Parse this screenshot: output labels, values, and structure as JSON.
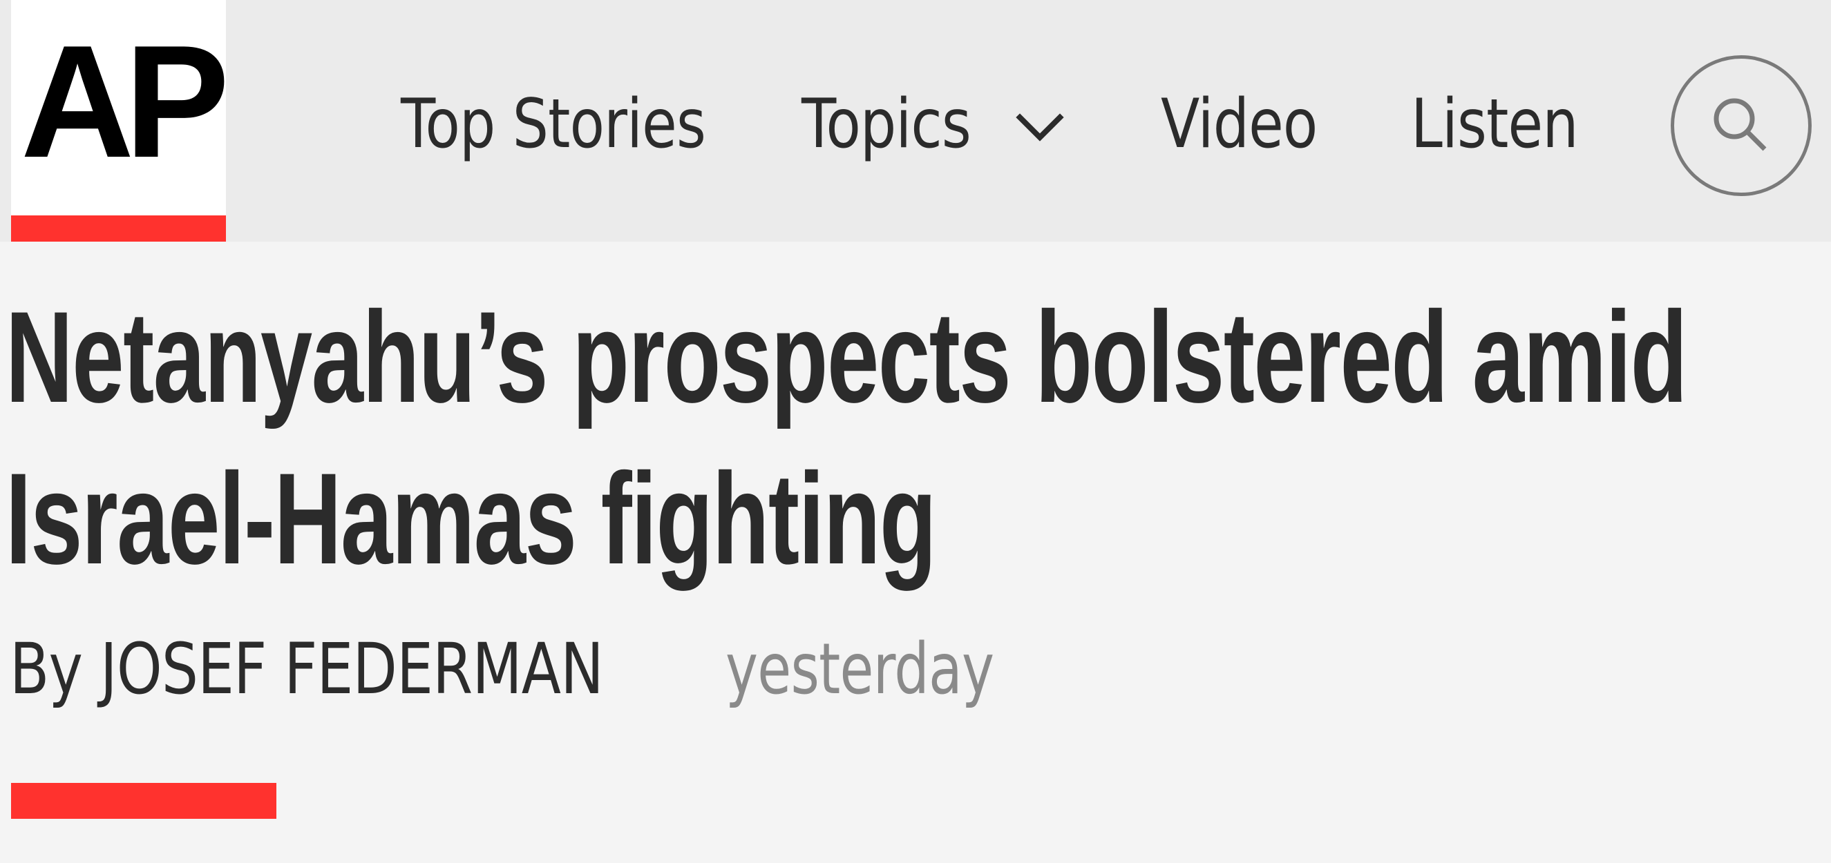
{
  "header": {
    "logo_text": "AP",
    "nav": {
      "top_stories": "Top Stories",
      "topics": "Topics",
      "video": "Video",
      "listen": "Listen"
    },
    "icons": {
      "topics_dropdown": "chevron-down-icon",
      "search": "search-icon"
    }
  },
  "article": {
    "headline": "Netanyahu’s prospects bolstered amid Israel-Hamas fighting",
    "byline_prefix": "By",
    "author": "JOSEF FEDERMAN",
    "timestamp": "yesterday"
  },
  "colors": {
    "accent_red": "#ff322e",
    "header_bg": "#ebebeb",
    "page_bg": "#f4f4f4",
    "text": "#2b2b2b",
    "muted_text": "#8a8a8a"
  }
}
